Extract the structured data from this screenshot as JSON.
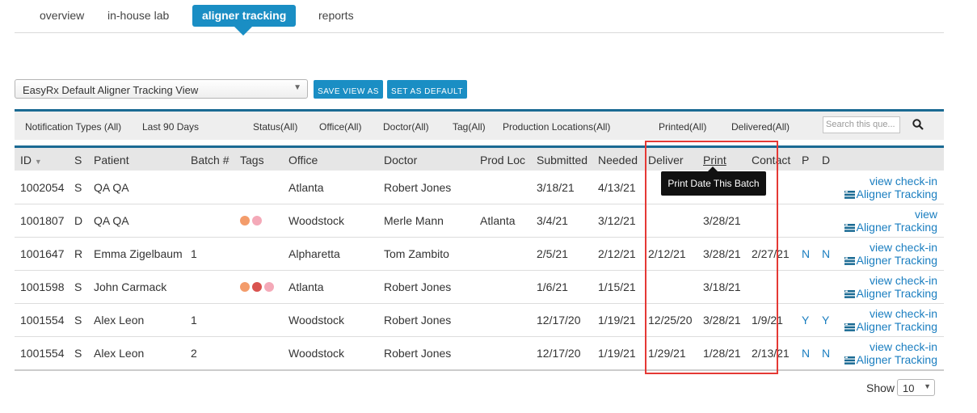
{
  "nav": {
    "tabs": [
      {
        "label": "overview"
      },
      {
        "label": "in-house lab"
      },
      {
        "label": "aligner tracking"
      },
      {
        "label": "reports"
      }
    ]
  },
  "view": {
    "selected": "EasyRx Default Aligner Tracking View",
    "save_view_as": "SAVE VIEW AS",
    "set_as_default": "SET AS DEFAULT"
  },
  "filters": {
    "notification_types": "Notification Types (All)",
    "last_days": "Last 90 Days",
    "status": "Status(All)",
    "office": "Office(All)",
    "doctor": "Doctor(All)",
    "tag": "Tag(All)",
    "production_locations": "Production Locations(All)",
    "printed": "Printed(All)",
    "delivered": "Delivered(All)",
    "search_placeholder": "Search this que..."
  },
  "table": {
    "headers": {
      "id": "ID",
      "s": "S",
      "patient": "Patient",
      "batch": "Batch #",
      "tags": "Tags",
      "office": "Office",
      "doctor": "Doctor",
      "prod_loc": "Prod Loc",
      "submitted": "Submitted",
      "needed": "Needed",
      "deliver": "Deliver",
      "print": "Print",
      "contact": "Contact",
      "p": "P",
      "d": "D"
    },
    "rows": [
      {
        "id": "1002054",
        "s": "S",
        "patient": "QA QA",
        "batch": "",
        "office": "Atlanta",
        "doctor": "Robert Jones",
        "prod_loc": "",
        "submitted": "3/18/21",
        "needed": "4/13/21",
        "deliver": "",
        "print": "",
        "contact": "",
        "p": "",
        "d": "",
        "view": "view check-in",
        "aligner": "Aligner Tracking",
        "tags": []
      },
      {
        "id": "1001807",
        "s": "D",
        "patient": "QA QA",
        "batch": "",
        "office": "Woodstock",
        "doctor": "Merle Mann",
        "prod_loc": "Atlanta",
        "submitted": "3/4/21",
        "needed": "3/12/21",
        "deliver": "",
        "print": "3/28/21",
        "contact": "",
        "p": "",
        "d": "",
        "view": "view",
        "aligner": "Aligner Tracking",
        "tags": [
          "#f39c6b",
          "#f4a9b8"
        ]
      },
      {
        "id": "1001647",
        "s": "R",
        "patient": "Emma Zigelbaum",
        "batch": "1",
        "office": "Alpharetta",
        "doctor": "Tom Zambito",
        "prod_loc": "",
        "submitted": "2/5/21",
        "needed": "2/12/21",
        "deliver": "2/12/21",
        "print": "3/28/21",
        "contact": "2/27/21",
        "p": "N",
        "d": "N",
        "view": "view check-in",
        "aligner": "Aligner Tracking",
        "tags": []
      },
      {
        "id": "1001598",
        "s": "S",
        "patient": "John Carmack",
        "batch": "",
        "office": "Atlanta",
        "doctor": "Robert Jones",
        "prod_loc": "",
        "submitted": "1/6/21",
        "needed": "1/15/21",
        "deliver": "",
        "print": "3/18/21",
        "contact": "",
        "p": "",
        "d": "",
        "view": "view check-in",
        "aligner": "Aligner Tracking",
        "tags": [
          "#f39c6b",
          "#d9534f",
          "#f4a9b8"
        ]
      },
      {
        "id": "1001554",
        "s": "S",
        "patient": "Alex Leon",
        "batch": "1",
        "office": "Woodstock",
        "doctor": "Robert Jones",
        "prod_loc": "",
        "submitted": "12/17/20",
        "needed": "1/19/21",
        "deliver": "12/25/20",
        "print": "3/28/21",
        "contact": "1/9/21",
        "p": "Y",
        "d": "Y",
        "view": "view check-in",
        "aligner": "Aligner Tracking",
        "tags": []
      },
      {
        "id": "1001554",
        "s": "S",
        "patient": "Alex Leon",
        "batch": "2",
        "office": "Woodstock",
        "doctor": "Robert Jones",
        "prod_loc": "",
        "submitted": "12/17/20",
        "needed": "1/19/21",
        "deliver": "1/29/21",
        "print": "1/28/21",
        "contact": "2/13/21",
        "p": "N",
        "d": "N",
        "view": "view check-in",
        "aligner": "Aligner Tracking",
        "tags": []
      }
    ]
  },
  "tooltip": "Print Date This Batch",
  "pagination": {
    "show_label": "Show",
    "page_size": "10"
  },
  "colors": {
    "accent": "#1a8ec4",
    "link": "#1a7ec0",
    "highlight": "#e53935"
  }
}
